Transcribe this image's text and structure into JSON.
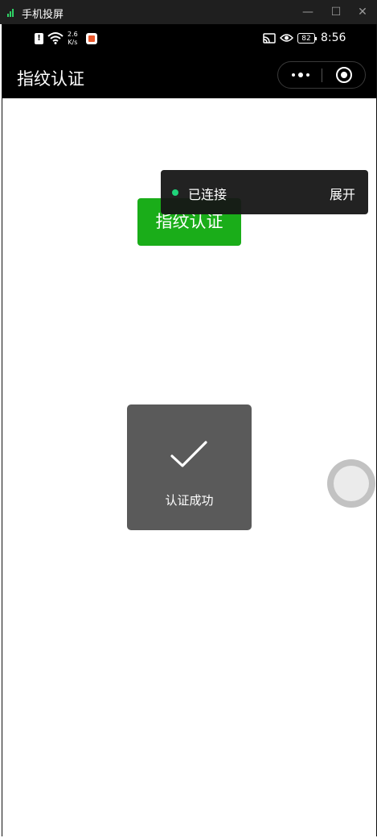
{
  "window": {
    "title": "手机投屏",
    "minimize_glyph": "—",
    "maximize_glyph": "☐",
    "close_glyph": "✕"
  },
  "statusbar": {
    "net_speed_value": "2.6",
    "net_speed_unit": "K/s",
    "battery": "82",
    "time": "8:56",
    "icons": [
      "alert-icon",
      "wifi-icon",
      "app-notification-icon",
      "cast-icon",
      "eye-icon",
      "battery-icon"
    ]
  },
  "navbar": {
    "title": "指纹认证"
  },
  "content": {
    "button_label": "指纹认证",
    "connection_status": "已连接",
    "connection_action": "展开",
    "toast_message": "认证成功"
  },
  "colors": {
    "primary_green": "#1aad19",
    "status_dot": "#1fd47a",
    "toast_bg": "#5a5a5a",
    "navbar_bg": "#000000"
  }
}
